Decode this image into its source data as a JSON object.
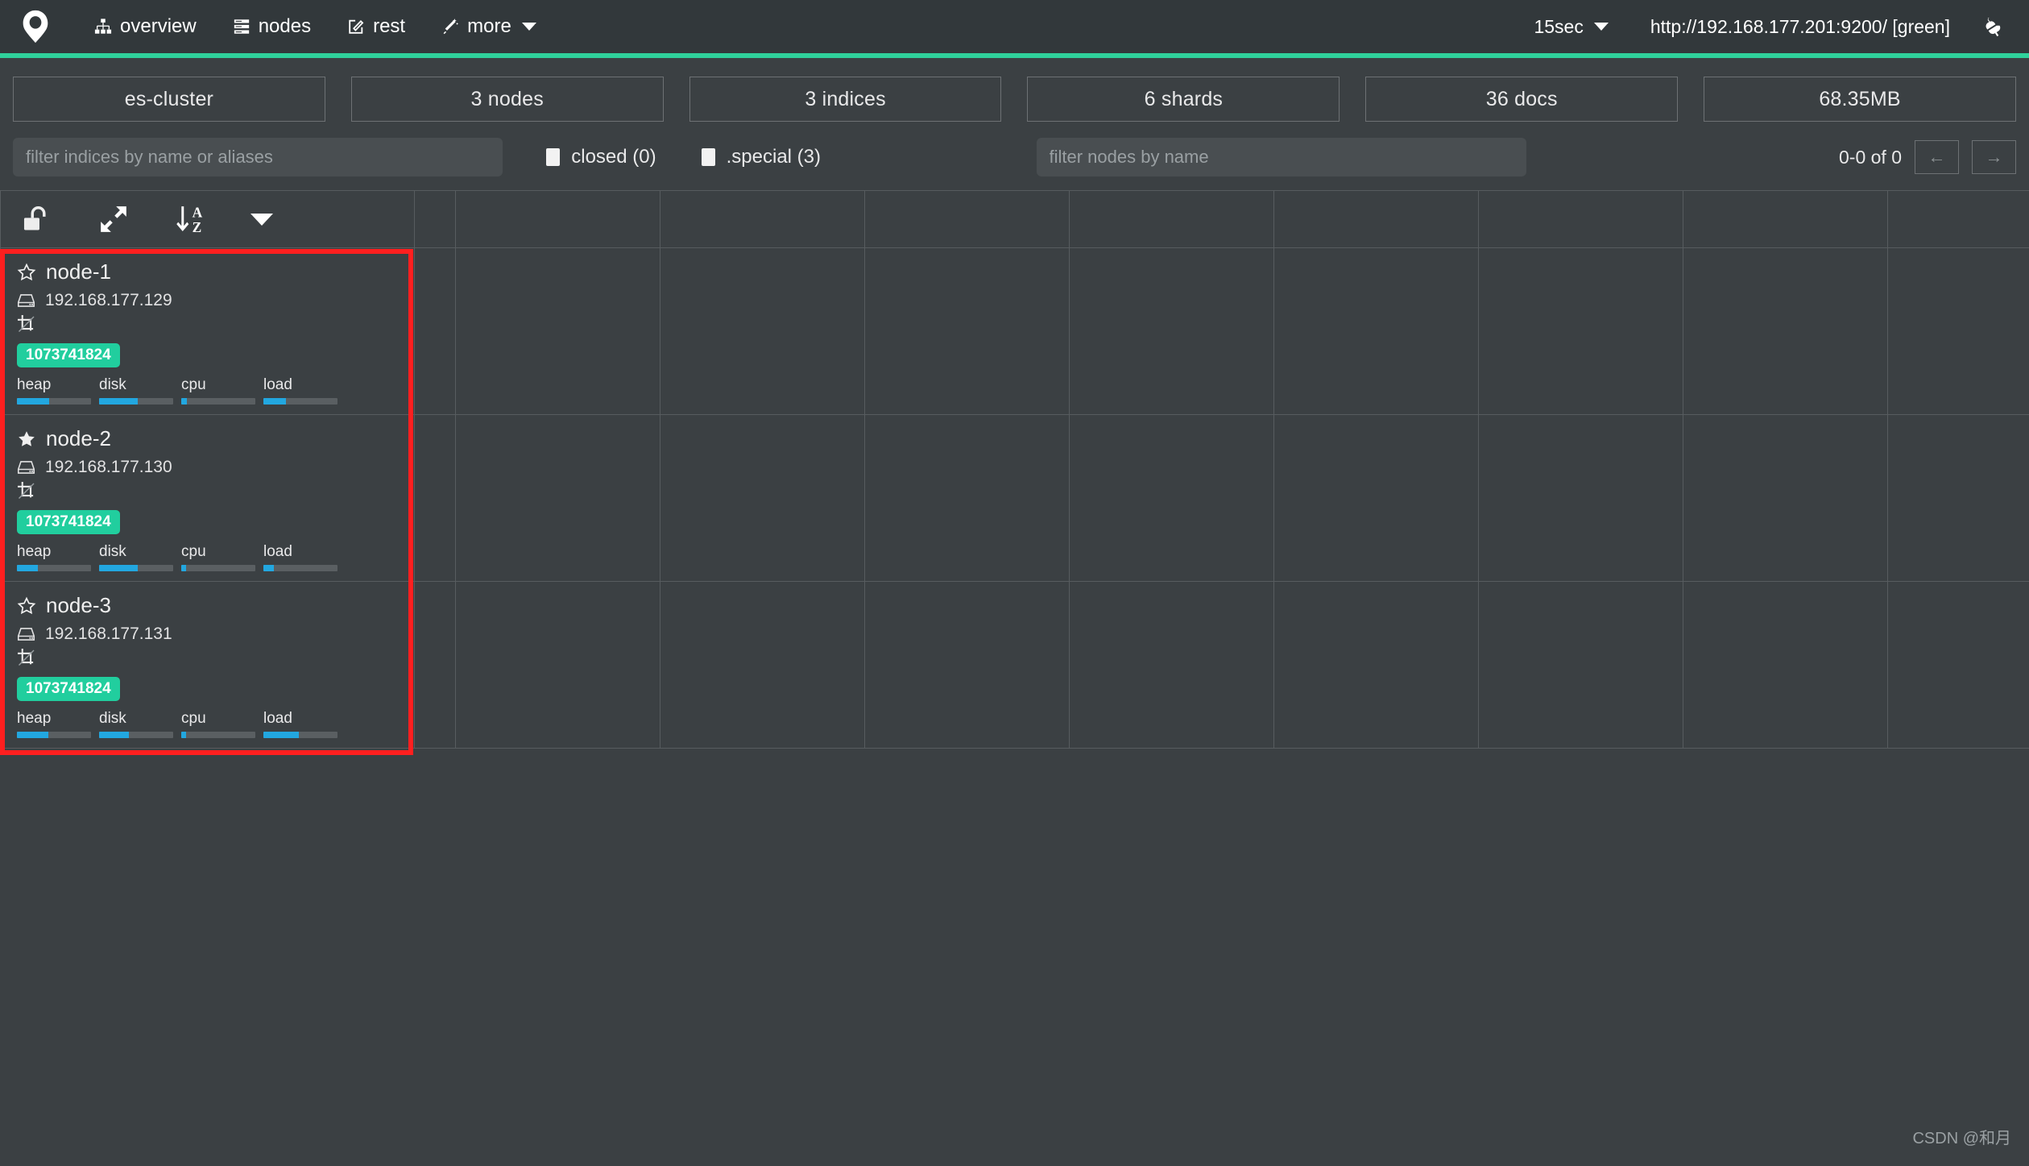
{
  "navbar": {
    "brand_icon": "cerebro-logo-icon",
    "links": [
      {
        "label": "overview",
        "icon": "sitemap-icon"
      },
      {
        "label": "nodes",
        "icon": "server-stack-icon"
      },
      {
        "label": "rest",
        "icon": "edit-square-icon"
      },
      {
        "label": "more",
        "icon": "magic-wand-icon",
        "has_caret": true
      }
    ],
    "refresh": {
      "label": "15sec",
      "icon": "refresh-icon",
      "has_caret": true
    },
    "cluster_url": "http://192.168.177.201:9200/ [green]",
    "disconnect_icon": "plug-icon",
    "accent_color": "#2fd19b",
    "background_color": "#32383b"
  },
  "stats": [
    {
      "label": "es-cluster"
    },
    {
      "label": "3 nodes"
    },
    {
      "label": "3 indices"
    },
    {
      "label": "6 shards"
    },
    {
      "label": "36 docs"
    },
    {
      "label": "68.35MB"
    }
  ],
  "filters": {
    "indices_placeholder": "filter indices by name or aliases",
    "indices_value": "",
    "nodes_placeholder": "filter nodes by name",
    "nodes_value": "",
    "checkboxes": [
      {
        "label": "closed (0)",
        "checked": false
      },
      {
        "label": ".special (3)",
        "checked": false
      }
    ],
    "pager": {
      "range_label": "0-0 of 0",
      "prev_label": "←",
      "next_label": "→"
    }
  },
  "toolbar": {
    "buttons": [
      {
        "name": "unlock-icon",
        "title": "toggle lock"
      },
      {
        "name": "expand-arrows-icon",
        "title": "expand"
      },
      {
        "name": "sort-az-icon",
        "title": "sort a-z"
      },
      {
        "name": "chevron-down-icon",
        "title": "more options"
      }
    ]
  },
  "nodes": [
    {
      "name": "node-1",
      "ip": "192.168.177.129",
      "master": false,
      "roles_icon": "crop-icon",
      "heap_max": "1073741824",
      "heap_badge_color": "#21ce9e",
      "metrics": [
        {
          "label": "heap",
          "percent": 44
        },
        {
          "label": "disk",
          "percent": 52
        },
        {
          "label": "cpu",
          "percent": 8
        },
        {
          "label": "load",
          "percent": 30
        }
      ]
    },
    {
      "name": "node-2",
      "ip": "192.168.177.130",
      "master": true,
      "roles_icon": "crop-icon",
      "heap_max": "1073741824",
      "heap_badge_color": "#21ce9e",
      "metrics": [
        {
          "label": "heap",
          "percent": 28
        },
        {
          "label": "disk",
          "percent": 52
        },
        {
          "label": "cpu",
          "percent": 7
        },
        {
          "label": "load",
          "percent": 14
        }
      ]
    },
    {
      "name": "node-3",
      "ip": "192.168.177.131",
      "master": false,
      "roles_icon": "crop-icon",
      "heap_max": "1073741824",
      "heap_badge_color": "#21ce9e",
      "metrics": [
        {
          "label": "heap",
          "percent": 42
        },
        {
          "label": "disk",
          "percent": 40
        },
        {
          "label": "cpu",
          "percent": 7
        },
        {
          "label": "load",
          "percent": 48
        }
      ]
    }
  ],
  "annotation": {
    "color": "#ff1f1f"
  },
  "watermark": "CSDN @和月"
}
